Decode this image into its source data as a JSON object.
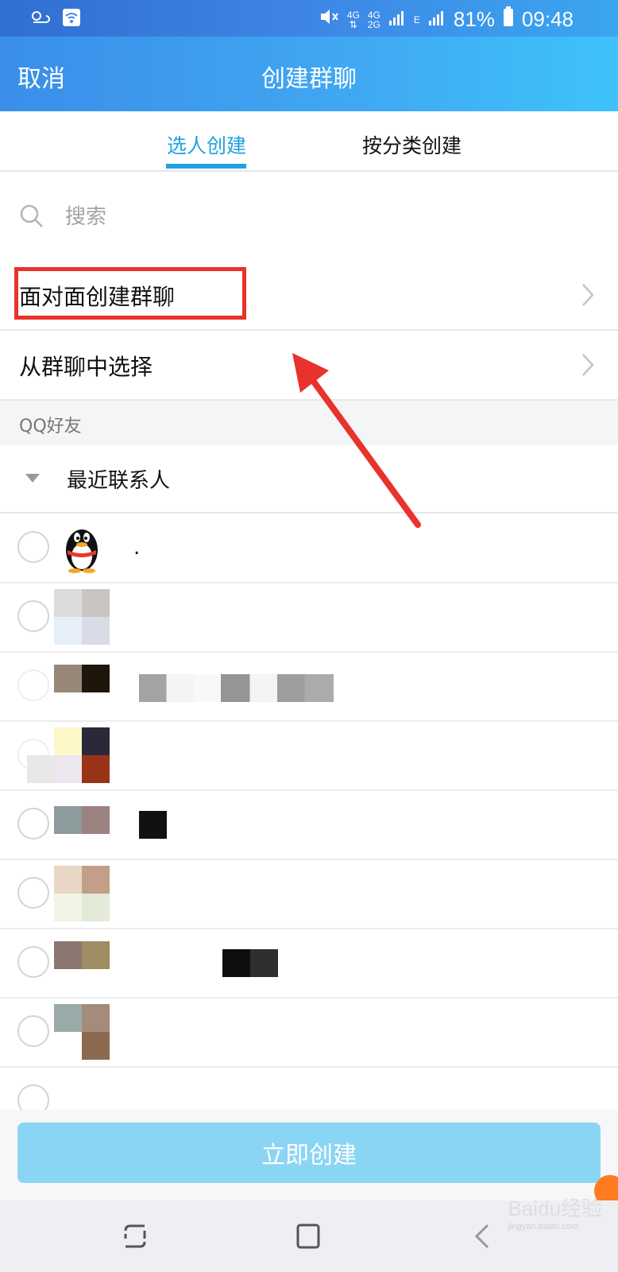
{
  "status_bar": {
    "net_4g_top": "4G",
    "net_4g2g_top": "4G",
    "net_4g2g_bottom": "2G",
    "net_e": "E",
    "battery": "81%",
    "time": "09:48"
  },
  "header": {
    "cancel_label": "取消",
    "title": "创建群聊"
  },
  "tabs": [
    {
      "label": "选人创建"
    },
    {
      "label": "按分类创建"
    }
  ],
  "search": {
    "placeholder": "搜索"
  },
  "menu": {
    "face_to_face": "面对面创建群聊",
    "from_group": "从群聊中选择"
  },
  "section": {
    "label": "QQ好友"
  },
  "group": {
    "label": "最近联系人"
  },
  "contacts": [
    {
      "name": "."
    }
  ],
  "bottom": {
    "create_label": "立即创建"
  },
  "watermark": {
    "brand": "Baidu经验",
    "url": "jingyan.baidu.com"
  },
  "colors": {
    "accent": "#1fa1e1",
    "header_start": "#3a8ee9",
    "header_end": "#3ec2fb",
    "create_button": "#8ad5f4",
    "highlight_box": "#e8322c"
  },
  "icons": {
    "search": "search-icon",
    "chevron": "chevron-right-icon",
    "group_toggle": "triangle-down-icon",
    "nav_back": "back-icon",
    "nav_home": "home-icon",
    "nav_recent": "recent-apps-icon"
  }
}
